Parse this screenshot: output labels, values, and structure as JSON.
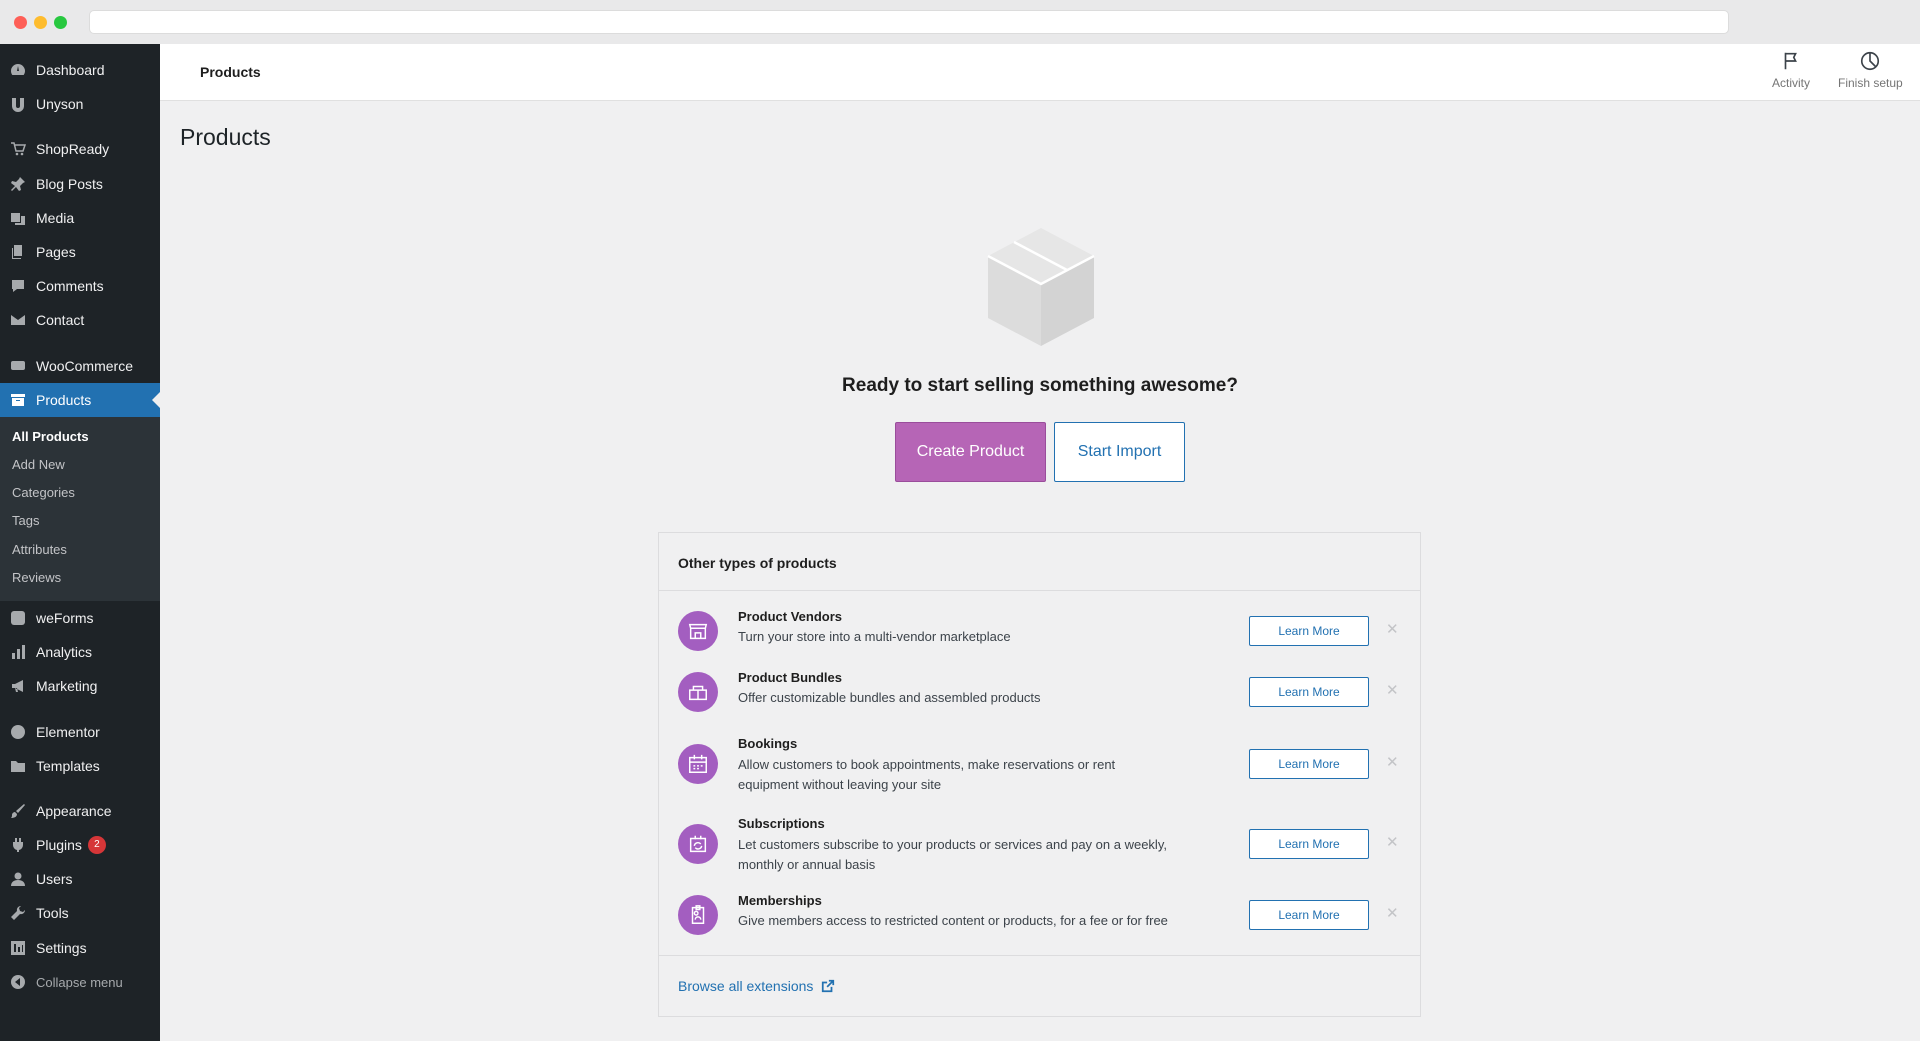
{
  "sidebar": {
    "items": [
      {
        "label": "Dashboard",
        "icon": "dashboard-icon"
      },
      {
        "label": "Unyson",
        "icon": "unyson-icon"
      },
      {
        "label": "ShopReady",
        "icon": "cart-icon"
      },
      {
        "label": "Blog Posts",
        "icon": "pin-icon"
      },
      {
        "label": "Media",
        "icon": "media-icon"
      },
      {
        "label": "Pages",
        "icon": "pages-icon"
      },
      {
        "label": "Comments",
        "icon": "comment-icon"
      },
      {
        "label": "Contact",
        "icon": "mail-icon"
      },
      {
        "label": "WooCommerce",
        "icon": "woo-icon"
      },
      {
        "label": "Products",
        "icon": "archive-icon"
      },
      {
        "label": "weForms",
        "icon": "weforms-icon"
      },
      {
        "label": "Analytics",
        "icon": "analytics-icon"
      },
      {
        "label": "Marketing",
        "icon": "megaphone-icon"
      },
      {
        "label": "Elementor",
        "icon": "elementor-icon"
      },
      {
        "label": "Templates",
        "icon": "folder-icon"
      },
      {
        "label": "Appearance",
        "icon": "brush-icon"
      },
      {
        "label": "Plugins",
        "icon": "plugin-icon"
      },
      {
        "label": "Users",
        "icon": "user-icon"
      },
      {
        "label": "Tools",
        "icon": "wrench-icon"
      },
      {
        "label": "Settings",
        "icon": "settings-icon"
      }
    ],
    "plugins_badge": "2",
    "submenu": [
      "All Products",
      "Add New",
      "Categories",
      "Tags",
      "Attributes",
      "Reviews"
    ],
    "collapse_label": "Collapse menu",
    "accent_color": "#2271b1"
  },
  "topbar": {
    "breadcrumb": "Products",
    "activity_label": "Activity",
    "finish_setup_label": "Finish setup"
  },
  "page": {
    "title": "Products",
    "hero_title": "Ready to start selling something awesome?",
    "create_button": "Create Product",
    "import_button": "Start Import",
    "primary_color": "#b665b6"
  },
  "card": {
    "title": "Other types of products",
    "learn_more": "Learn More",
    "products": [
      {
        "title": "Product Vendors",
        "desc": "Turn your store into a multi-vendor marketplace",
        "icon": "vendor-icon"
      },
      {
        "title": "Product Bundles",
        "desc": "Offer customizable bundles and assembled products",
        "icon": "bundle-icon"
      },
      {
        "title": "Bookings",
        "desc": "Allow customers to book appointments, make reservations or rent equipment without leaving your site",
        "icon": "calendar-icon"
      },
      {
        "title": "Subscriptions",
        "desc": "Let customers subscribe to your products or services and pay on a weekly, monthly or annual basis",
        "icon": "subscription-icon"
      },
      {
        "title": "Memberships",
        "desc": "Give members access to restricted content or products, for a fee or for free",
        "icon": "membership-icon"
      }
    ],
    "browse_label": "Browse all extensions"
  }
}
